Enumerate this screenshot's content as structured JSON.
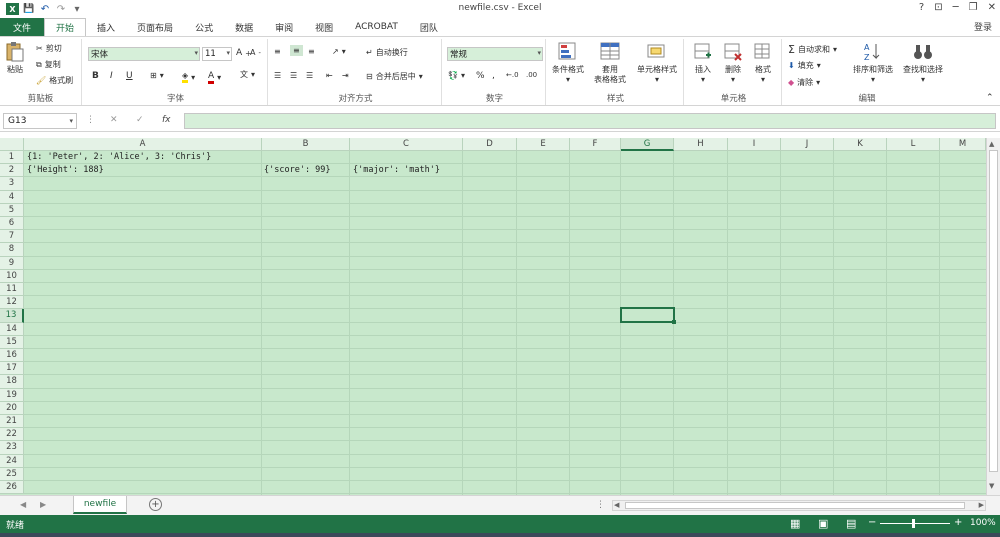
{
  "window": {
    "title": "newfile.csv - Excel",
    "help": "?",
    "ribbon_display": "⊡",
    "minimize": "─",
    "restore": "❐",
    "close": "✕"
  },
  "qat": {
    "save": "💾",
    "undo": "↶",
    "redo": "↷",
    "customize": "▾"
  },
  "tabs": [
    "文件",
    "开始",
    "插入",
    "页面布局",
    "公式",
    "数据",
    "审阅",
    "视图",
    "ACROBAT",
    "团队"
  ],
  "signin": "登录",
  "ribbon": {
    "clipboard": {
      "paste": "粘贴",
      "cut": "剪切",
      "copy": "复制",
      "format_painter": "格式刷",
      "label": "剪贴板"
    },
    "font": {
      "name": "宋体",
      "size": "11",
      "bold": "B",
      "italic": "I",
      "underline": "U",
      "label": "字体"
    },
    "alignment": {
      "wrap": "自动换行",
      "merge": "合并后居中",
      "label": "对齐方式"
    },
    "number": {
      "format": "常规",
      "percent": "%",
      "comma": ",",
      "label": "数字"
    },
    "styles": {
      "conditional": "条件格式",
      "table1": "套用",
      "table2": "表格格式",
      "cell_styles": "单元格样式",
      "label": "样式"
    },
    "cells": {
      "insert": "插入",
      "delete": "删除",
      "format": "格式",
      "label": "单元格"
    },
    "editing": {
      "autosum": "自动求和",
      "fill": "填充",
      "clear": "清除",
      "sort": "排序和筛选",
      "find": "查找和选择",
      "label": "编辑"
    }
  },
  "formula_bar": {
    "name_box": "G13",
    "cancel": "✕",
    "enter": "✓",
    "fx": "fx",
    "value": ""
  },
  "columns": [
    "A",
    "B",
    "C",
    "D",
    "E",
    "F",
    "G",
    "H",
    "I",
    "J",
    "K",
    "L",
    "M"
  ],
  "rows": [
    "1",
    "2",
    "3",
    "4",
    "5",
    "6",
    "7",
    "8",
    "9",
    "10",
    "11",
    "12",
    "13",
    "14",
    "15",
    "16",
    "17",
    "18",
    "19",
    "20",
    "21",
    "22",
    "23",
    "24",
    "25",
    "26"
  ],
  "cells": {
    "A1": "{1: 'Peter', 2: 'Alice', 3: 'Chris'}",
    "A2": "{'Height': 188}",
    "B2": "{'score': 99}",
    "C2": "{'major': 'math'}"
  },
  "sheets": [
    "newfile"
  ],
  "status": {
    "ready": "就绪",
    "zoom": "100%"
  }
}
